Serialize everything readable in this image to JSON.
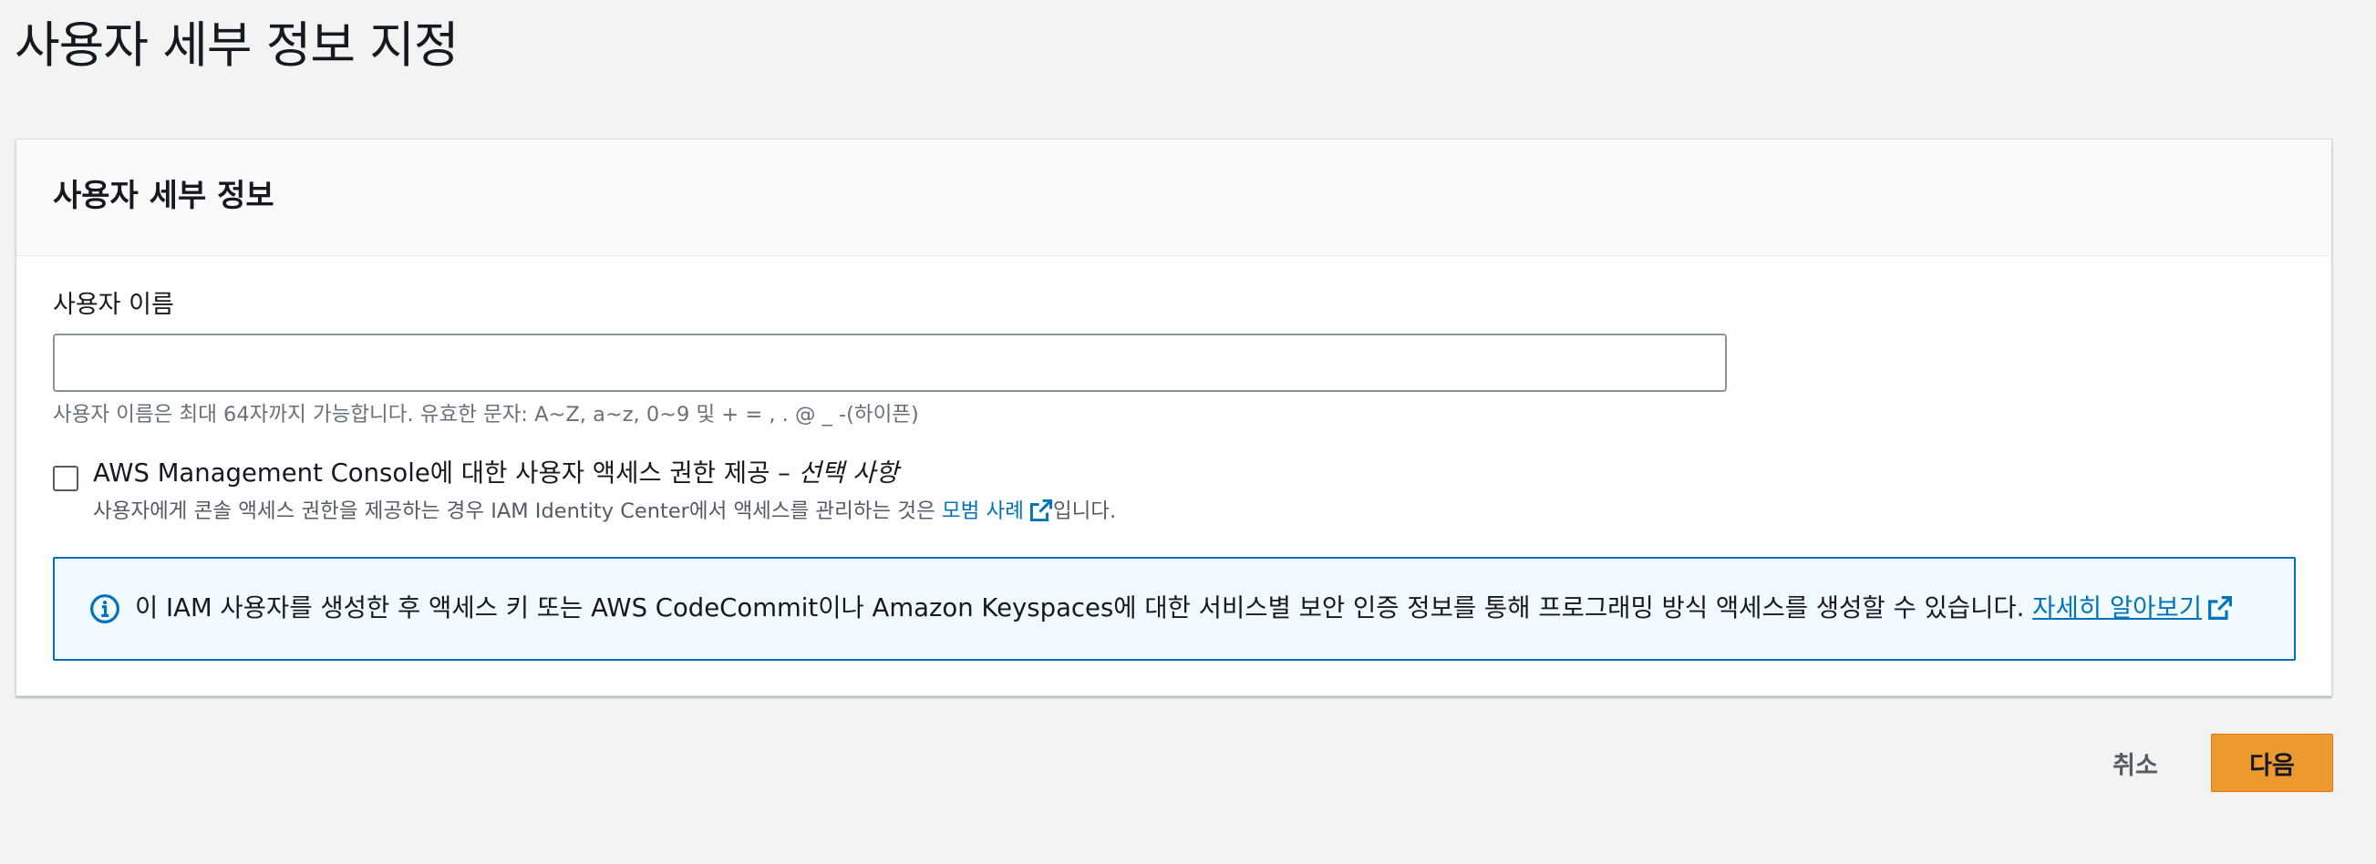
{
  "page": {
    "title": "사용자 세부 정보 지정"
  },
  "user_details": {
    "section_title": "사용자 세부 정보",
    "username": {
      "label": "사용자 이름",
      "value": "",
      "placeholder": "",
      "hint": "사용자 이름은 최대 64자까지 가능합니다. 유효한 문자: A~Z, a~z, 0~9 및 + = , . @ _ -(하이픈)"
    },
    "console_access": {
      "checked": false,
      "label": "AWS Management Console에 대한 사용자 액세스 권한 제공",
      "dash": " – ",
      "optional": "선택 사항",
      "description_prefix": "사용자에게 콘솔 액세스 권한을 제공하는 경우 IAM Identity Center에서 액세스를 관리하는 것은 ",
      "best_practice_link": "모범 사례",
      "description_suffix": "입니다."
    },
    "info_alert": {
      "icon": "info-icon",
      "text": "이 IAM 사용자를 생성한 후 액세스 키 또는 AWS CodeCommit이나 Amazon Keyspaces에 대한 서비스별 보안 인증 정보를 통해 프로그래밍 방식 액세스를 생성할 수 있습니다. ",
      "learn_more_link": "자세히 알아보기"
    }
  },
  "actions": {
    "cancel_label": "취소",
    "next_label": "다음"
  },
  "colors": {
    "primary_button": "#ec9a2f",
    "link": "#0073bb",
    "info_border": "#0073bb",
    "info_background": "#f1faff"
  }
}
